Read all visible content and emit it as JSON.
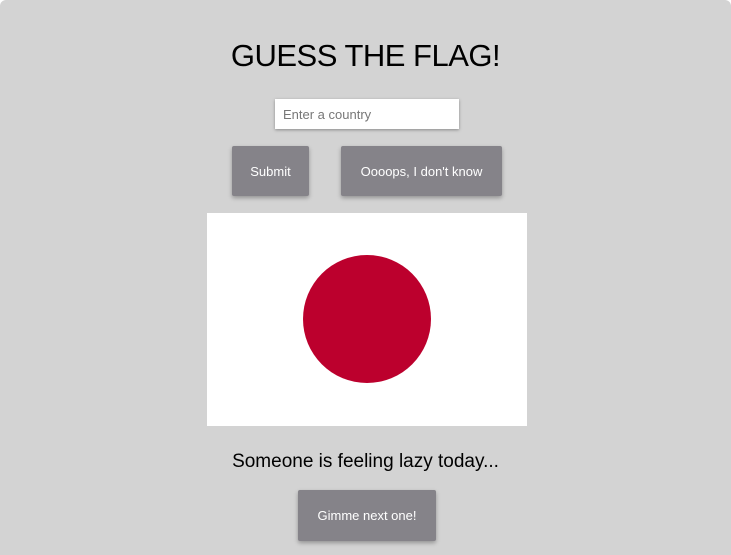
{
  "game": {
    "title": "GUESS THE FLAG!",
    "input": {
      "placeholder": "Enter a country",
      "value": ""
    },
    "buttons": {
      "submit": "Submit",
      "dont_know": "Oooops, I don't know",
      "next": "Gimme next one!"
    },
    "flag": {
      "icon": "japan-flag",
      "field_color": "#ffffff",
      "disc_color": "#bc002d"
    },
    "message": "Someone is feeling lazy today..."
  },
  "colors": {
    "background": "#d3d3d3",
    "button": "#858389"
  }
}
